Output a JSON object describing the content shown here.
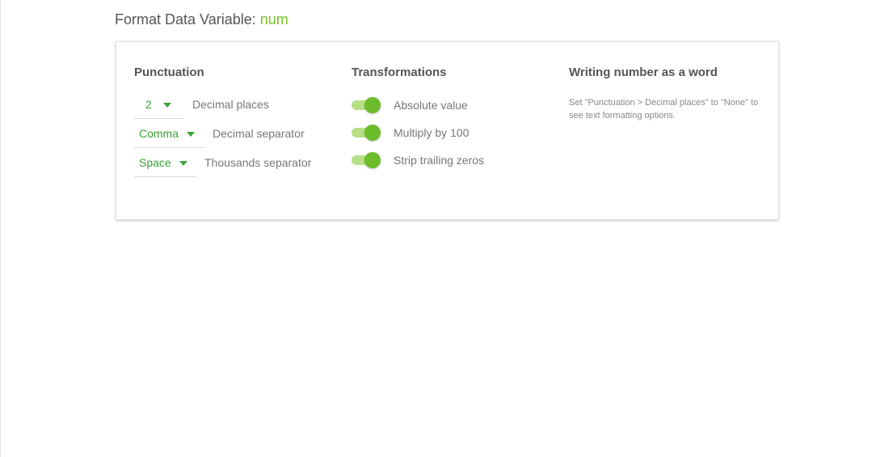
{
  "header": {
    "title_prefix": "Format Data Variable:",
    "variable_name": "num"
  },
  "colors": {
    "accent": "#78be28",
    "dropdown_text": "#3aa335",
    "toggle_knob": "#6cbc2b",
    "toggle_track": "#b6df86"
  },
  "punctuation": {
    "heading": "Punctuation",
    "rows": [
      {
        "value": "2",
        "label": "Decimal places"
      },
      {
        "value": "Comma",
        "label": "Decimal separator"
      },
      {
        "value": "Space",
        "label": "Thousands separator"
      }
    ]
  },
  "transformations": {
    "heading": "Transformations",
    "toggles": [
      {
        "label": "Absolute value",
        "on": true
      },
      {
        "label": "Multiply by 100",
        "on": true
      },
      {
        "label": "Strip trailing zeros",
        "on": true
      }
    ]
  },
  "words": {
    "heading": "Writing number as a word",
    "note": "Set \"Punctuation > Decimal places\" to \"None\" to see text formatting options."
  },
  "icons": {
    "dropdown_caret": "caret-down-icon"
  }
}
